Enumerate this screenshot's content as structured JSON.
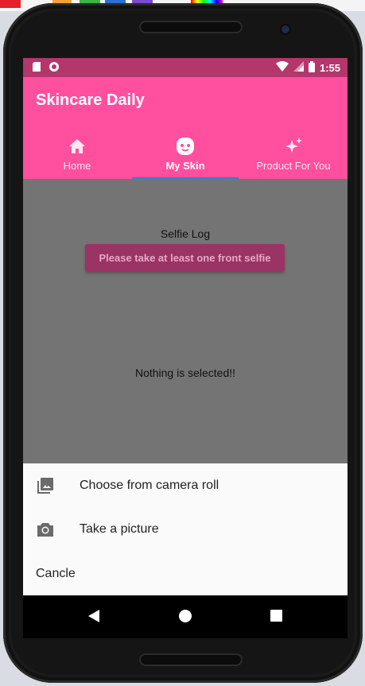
{
  "status_bar": {
    "time": "1:55"
  },
  "app_bar": {
    "title": "Skincare Daily"
  },
  "tabs": [
    {
      "label": "Home",
      "icon": "home-icon",
      "active": false
    },
    {
      "label": "My Skin",
      "icon": "face-icon",
      "active": true
    },
    {
      "label": "Product For You",
      "icon": "sparkle-icon",
      "active": false
    }
  ],
  "content": {
    "selfie_label": "Selfie Log",
    "selfie_button": "Please take at least one front selfie",
    "empty_message": "Nothing is selected!!"
  },
  "bottom_sheet": {
    "camera_roll": {
      "label": "Choose from camera roll",
      "icon": "photo-library-icon"
    },
    "take_picture": {
      "label": "Take a picture",
      "icon": "camera-icon"
    },
    "cancel": {
      "label": "Cancle"
    }
  },
  "colors": {
    "accent": "#ff4f9e",
    "status_bar": "#b5366b",
    "tab_indicator": "#3a7bd5"
  }
}
